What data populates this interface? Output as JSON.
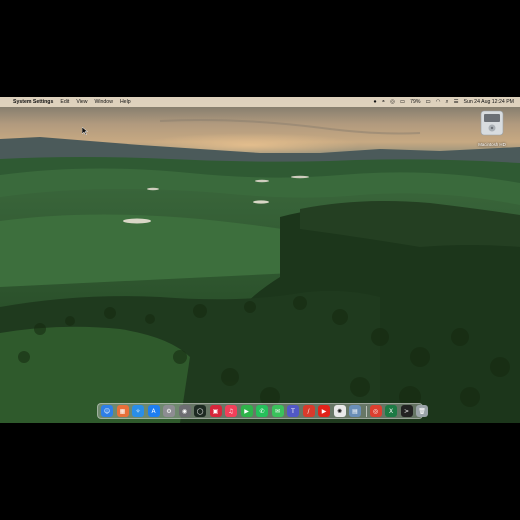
{
  "menubar": {
    "app_name": "System Settings",
    "menus": [
      "Edit",
      "View",
      "Window",
      "Help"
    ],
    "battery_percent": "79%",
    "datetime": "Sun 24 Aug  12:24 PM",
    "status_icons": [
      "record-icon",
      "user-icon",
      "screen-icon",
      "keyboard-icon",
      "battery-icon",
      "wifi-icon",
      "search-icon",
      "control-center-icon"
    ]
  },
  "desktop": {
    "drive_label": "Macintosh HD"
  },
  "dock": {
    "apps_left": [
      {
        "name": "finder-icon",
        "color": "#2f7fe6",
        "glyph": "☺"
      },
      {
        "name": "launchpad-icon",
        "color": "#e8703a",
        "glyph": "▦"
      },
      {
        "name": "safari-icon",
        "color": "#2a8ee8",
        "glyph": "✧"
      },
      {
        "name": "app-store-icon",
        "color": "#1f7ef0",
        "glyph": "A"
      },
      {
        "name": "system-settings-icon",
        "color": "#8d8d92",
        "glyph": "⚙"
      },
      {
        "name": "disk-utility-icon",
        "color": "#6d6d72",
        "glyph": "◉"
      },
      {
        "name": "activity-ring-icon",
        "color": "#1d2a22",
        "glyph": "◯"
      },
      {
        "name": "photo-booth-icon",
        "color": "#d6263b",
        "glyph": "▣"
      },
      {
        "name": "music-icon",
        "color": "#f2405a",
        "glyph": "♫"
      },
      {
        "name": "facetime-icon",
        "color": "#2fb34a",
        "glyph": "▶"
      },
      {
        "name": "whatsapp-icon",
        "color": "#25c05a",
        "glyph": "✆"
      },
      {
        "name": "messages-icon",
        "color": "#3ac25b",
        "glyph": "✉"
      },
      {
        "name": "teams-icon",
        "color": "#5158c6",
        "glyph": "T"
      },
      {
        "name": "sketch-icon",
        "color": "#d93a2b",
        "glyph": "/"
      },
      {
        "name": "youtube-icon",
        "color": "#e2231a",
        "glyph": "▶"
      },
      {
        "name": "openai-icon",
        "color": "#e9e9e9",
        "glyph": "✺"
      },
      {
        "name": "preview-icon",
        "color": "#6a8fb8",
        "glyph": "▤"
      }
    ],
    "apps_right": [
      {
        "name": "chrome-icon",
        "color": "#dc3f2f",
        "glyph": "◎"
      },
      {
        "name": "excel-icon",
        "color": "#1d7a44",
        "glyph": "X"
      },
      {
        "name": "terminal-icon",
        "color": "#222",
        "glyph": ">"
      },
      {
        "name": "trash-icon",
        "color": "#9aa3a8",
        "glyph": "🗑"
      }
    ]
  }
}
